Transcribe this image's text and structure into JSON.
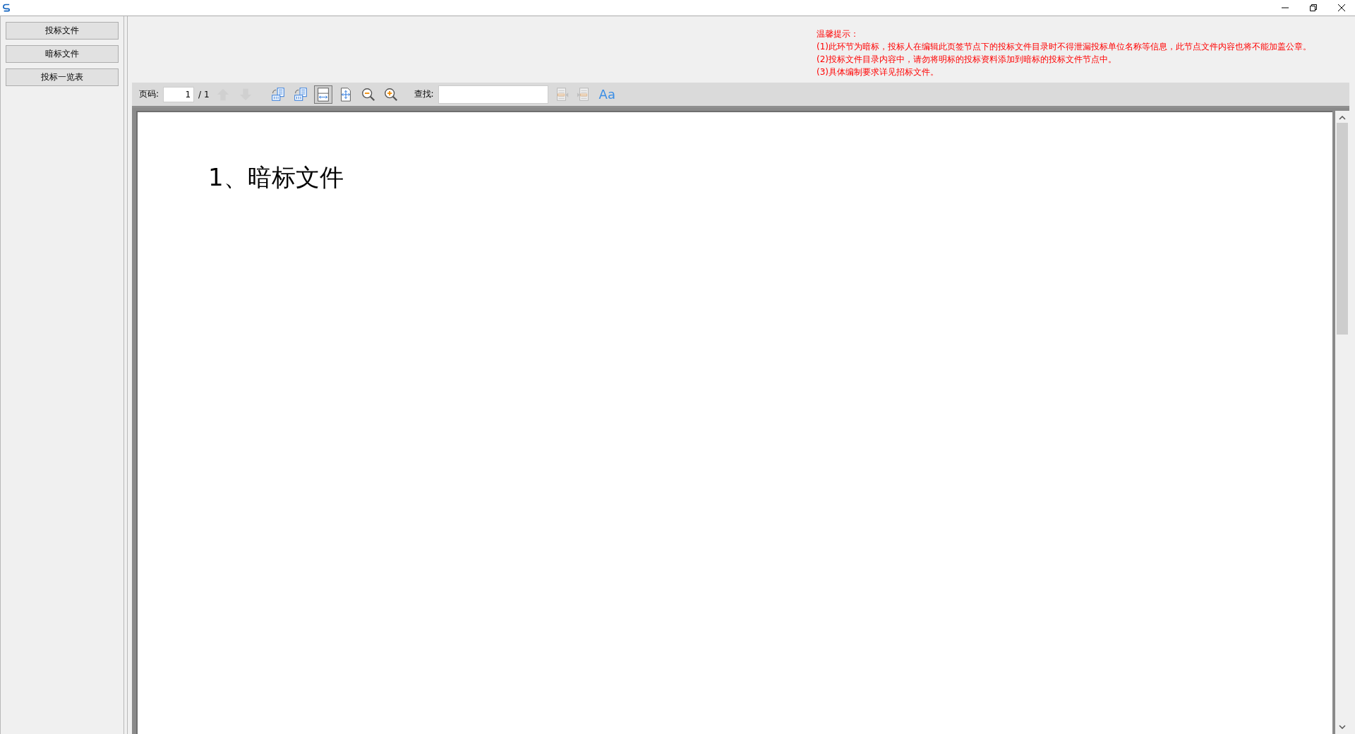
{
  "sidebar": {
    "items": [
      {
        "label": "投标文件"
      },
      {
        "label": "暗标文件"
      },
      {
        "label": "投标一览表"
      }
    ]
  },
  "notice": {
    "title": "温馨提示：",
    "lines": [
      "(1)此环节为暗标，投标人在编辑此页签节点下的投标文件目录时不得泄漏投标单位名称等信息，此节点文件内容也将不能加盖公章。",
      "(2)投标文件目录内容中，请勿将明标的投标资料添加到暗标的投标文件节点中。",
      "(3)具体编制要求详见招标文件。"
    ]
  },
  "toolbar": {
    "page_label": "页码:",
    "page_value": "1",
    "page_total": "/ 1",
    "find_label": "查找:",
    "tools": [
      {
        "kind": "up",
        "disabled": true,
        "selected": false
      },
      {
        "kind": "down",
        "disabled": true,
        "selected": false
      },
      {
        "kind": "rotate-left",
        "disabled": false,
        "selected": false
      },
      {
        "kind": "rotate-right",
        "disabled": false,
        "selected": false
      },
      {
        "kind": "fit-width",
        "disabled": false,
        "selected": true
      },
      {
        "kind": "fit-page",
        "disabled": false,
        "selected": false
      },
      {
        "kind": "zoom-out",
        "disabled": false,
        "selected": false
      },
      {
        "kind": "zoom-in",
        "disabled": false,
        "selected": false
      }
    ],
    "find_tools": [
      {
        "kind": "find-prev",
        "disabled": true
      },
      {
        "kind": "find-next",
        "disabled": true
      },
      {
        "kind": "case",
        "disabled": false,
        "label": "Aa"
      }
    ]
  },
  "document": {
    "heading": "1、暗标文件"
  }
}
